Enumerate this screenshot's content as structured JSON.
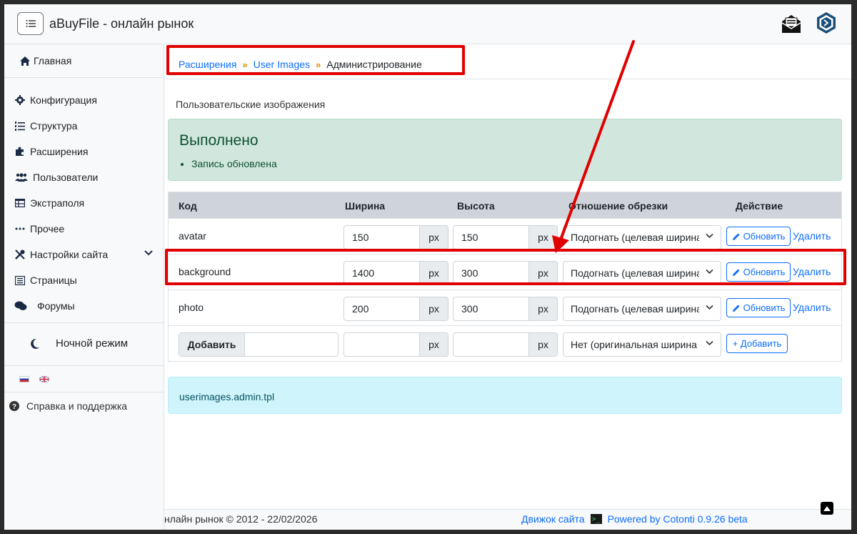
{
  "app": {
    "brand": "aBuyFile - онлайн рынок"
  },
  "sidebar": {
    "home": "Главная",
    "items": [
      {
        "label": "Конфигурация",
        "icon": "gear-icon"
      },
      {
        "label": "Структура",
        "icon": "list-ol-icon"
      },
      {
        "label": "Расширения",
        "icon": "puzzle-icon"
      },
      {
        "label": "Пользователи",
        "icon": "users-icon"
      },
      {
        "label": "Экстраполя",
        "icon": "table-icon"
      },
      {
        "label": "Прочее",
        "icon": "ellipsis-icon"
      },
      {
        "label": "Настройки сайта",
        "icon": "tools-icon"
      },
      {
        "label": "Страницы",
        "icon": "pages-icon"
      },
      {
        "label": "Форумы",
        "icon": "comments-icon"
      }
    ],
    "night_mode": "Ночной режим",
    "help": "Справка и поддержка"
  },
  "breadcrumb": {
    "items": [
      "Расширения",
      "User Images",
      "Администрирование"
    ],
    "separator": "»"
  },
  "page": {
    "title": "Пользовательские изображения"
  },
  "alert_success": {
    "title": "Выполнено",
    "message": "Запись обновлена"
  },
  "table": {
    "headers": [
      "Код",
      "Ширина",
      "Высота",
      "Отношение обрезки",
      "Действие"
    ],
    "unit": "px",
    "update_label": "Обновить",
    "delete_label": "Удалить",
    "rows": [
      {
        "code": "avatar",
        "width": "150",
        "height": "150",
        "crop": "Подогнать (целевая ширина"
      },
      {
        "code": "background",
        "width": "1400",
        "height": "300",
        "crop": "Подогнать (целевая ширина"
      },
      {
        "code": "photo",
        "width": "200",
        "height": "300",
        "crop": "Подогнать (целевая ширина"
      }
    ],
    "add_row": {
      "label": "Добавить",
      "crop": "Нет (оригинальная ширина",
      "button": "+ Добавить"
    }
  },
  "alert_info": {
    "text": "userimages.admin.tpl"
  },
  "footer": {
    "copyright": "нлайн рынок © 2012 - 22/02/2026",
    "engine": "Движок сайта",
    "powered": "Powered by Cotonti 0.9.26 beta"
  },
  "colors": {
    "accent": "#0d6efd",
    "annotation": "#e10000",
    "success_bg": "#d1e7dd",
    "info_bg": "#cff4fc"
  }
}
